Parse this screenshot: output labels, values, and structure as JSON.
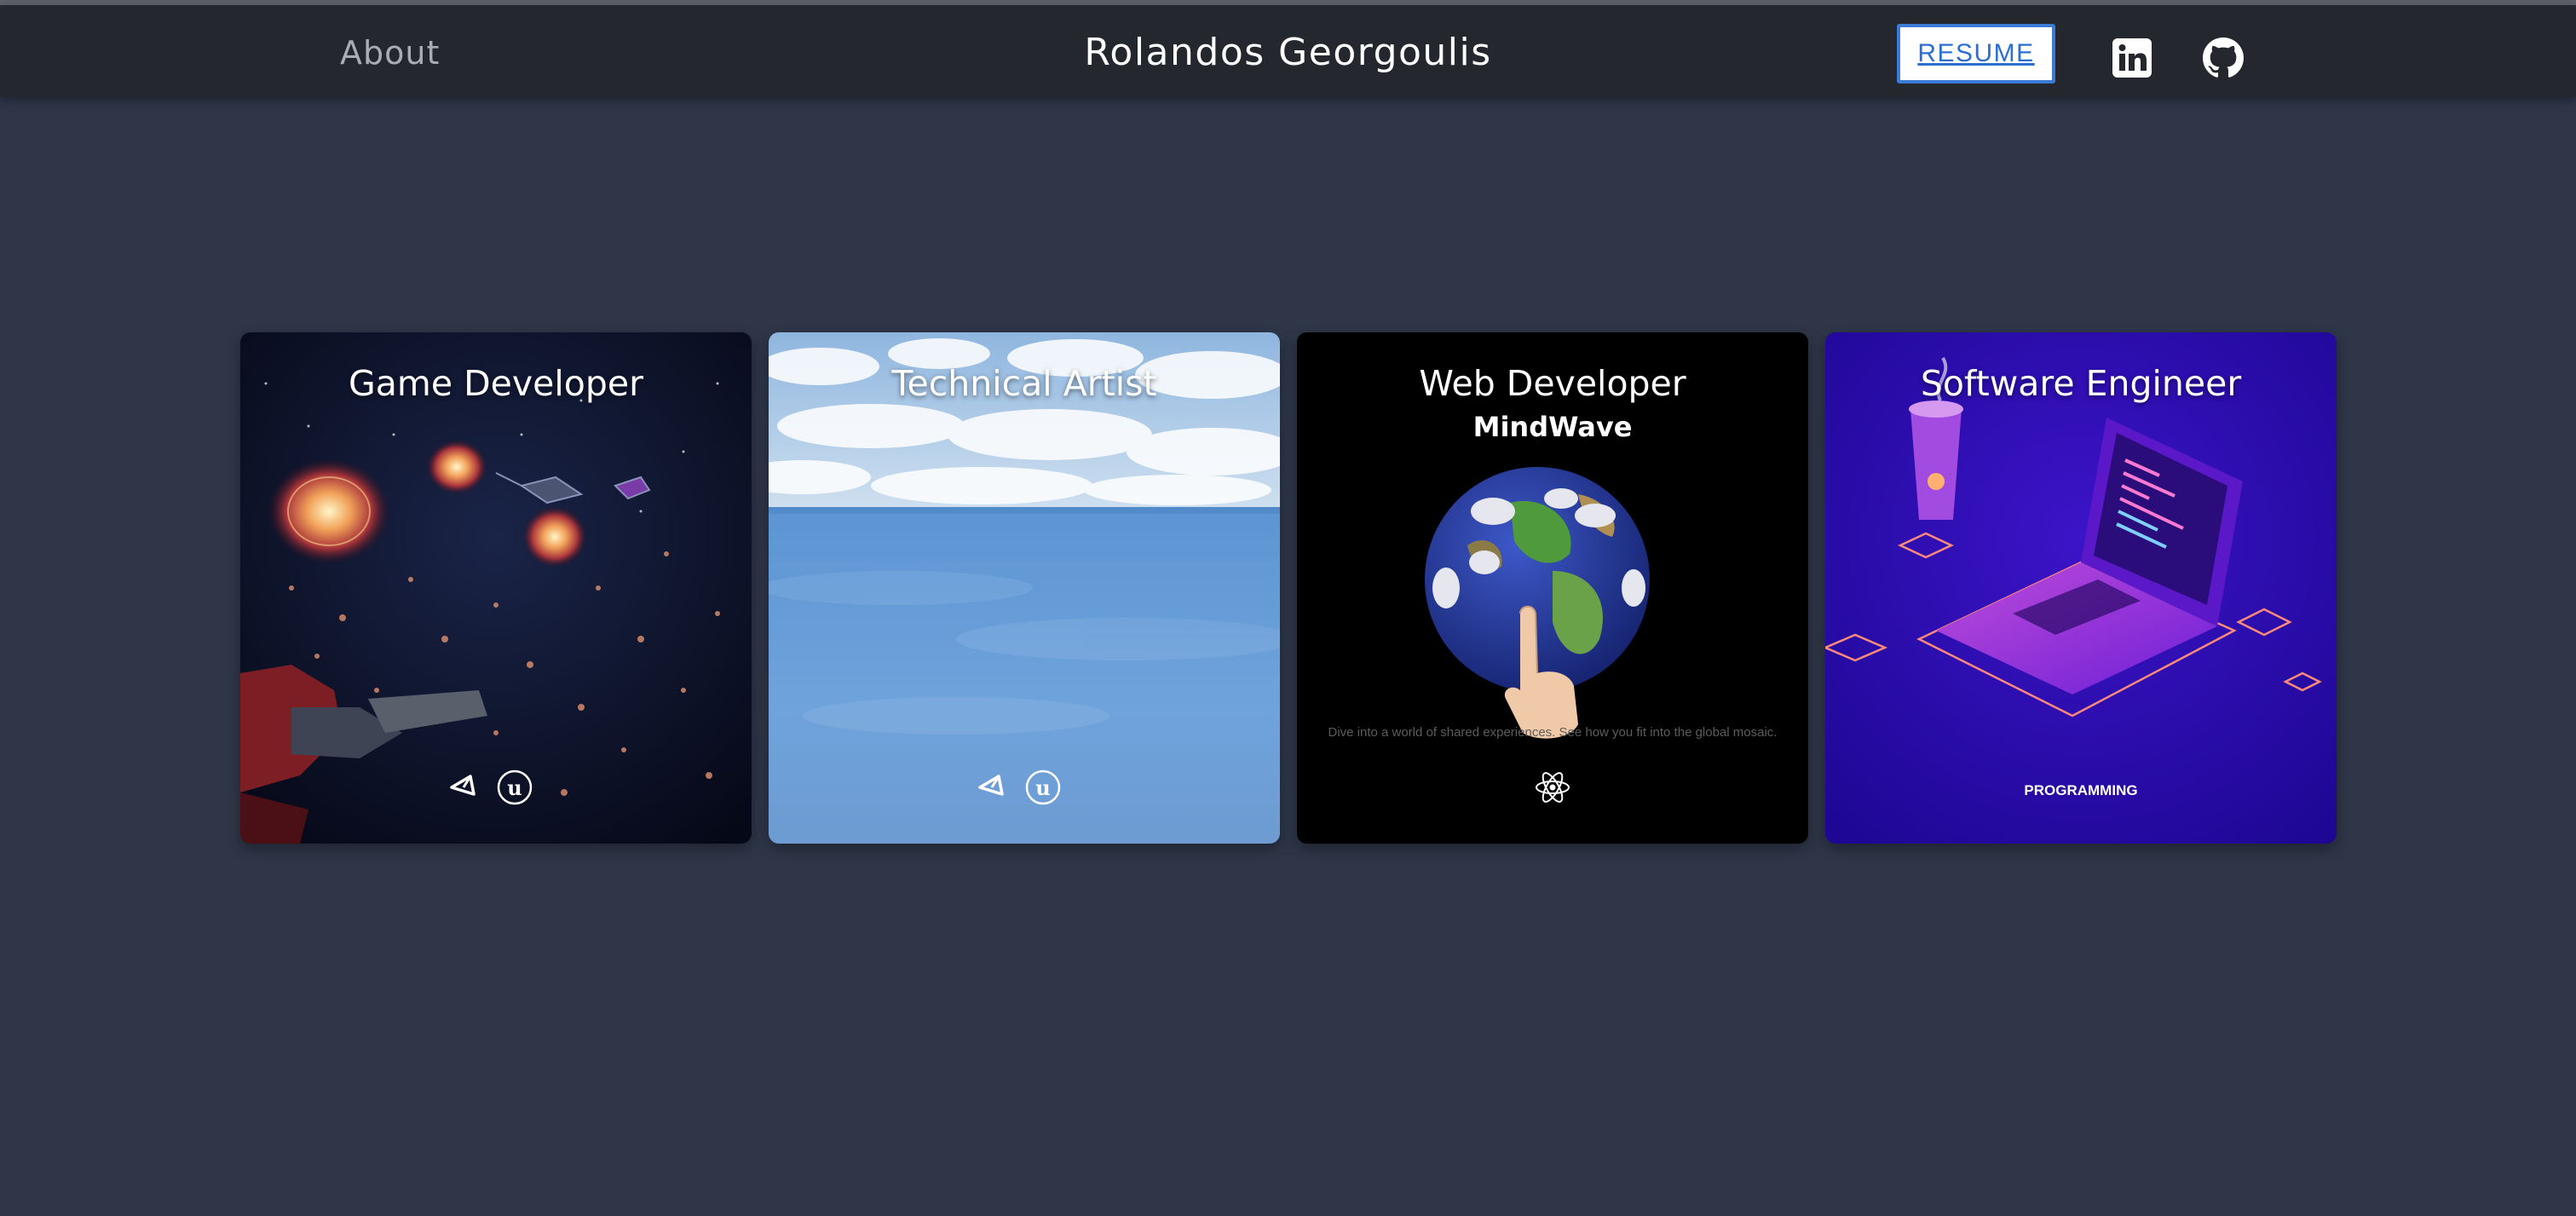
{
  "nav": {
    "about_label": "About",
    "site_title": "Rolandos Georgoulis",
    "resume_label": "RESUME",
    "linkedin_icon": "linkedin-icon",
    "github_icon": "github-icon"
  },
  "cards": [
    {
      "title": "Game Developer",
      "icons": [
        "unity-icon",
        "unreal-icon"
      ]
    },
    {
      "title": "Technical Artist",
      "icons": [
        "unity-icon",
        "unreal-icon"
      ]
    },
    {
      "title": "Web Developer",
      "brand": "MindWave",
      "tagline": "Dive into a world of shared experiences. See how you fit into the global mosaic.",
      "icons": [
        "react-icon"
      ]
    },
    {
      "title": "Software Engineer",
      "label": "PROGRAMMING"
    }
  ],
  "colors": {
    "page_bg": "#2e3648",
    "navbar_bg": "#24272d",
    "resume_border": "#3a7bd5",
    "resume_text": "#2a6fd1"
  }
}
